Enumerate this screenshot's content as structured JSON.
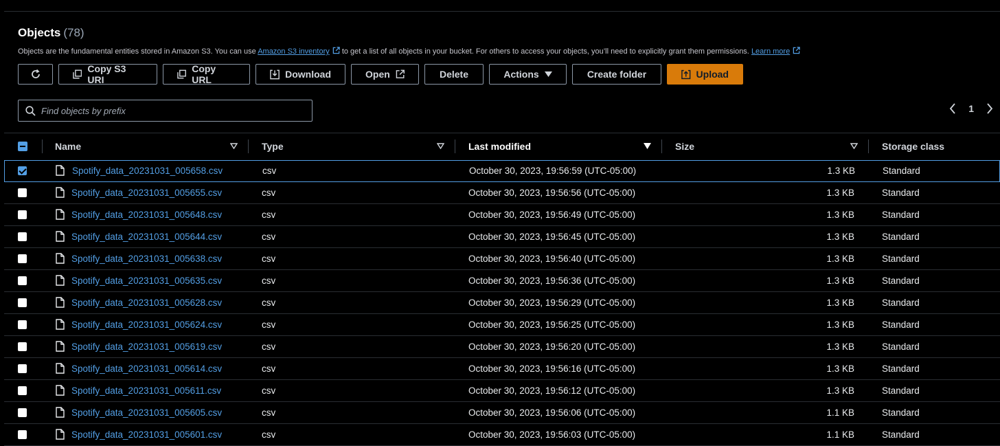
{
  "header": {
    "title": "Objects",
    "count": "(78)",
    "description_prefix": "Objects are the fundamental entities stored in Amazon S3. You can use",
    "inventory_link": "Amazon S3 inventory",
    "description_middle": "to get a list of all objects in your bucket. For others to access your objects, you’ll need to explicitly grant them permissions.",
    "learn_more": "Learn more"
  },
  "toolbar": {
    "copy_s3_uri": "Copy S3 URI",
    "copy_url": "Copy URL",
    "download": "Download",
    "open": "Open",
    "delete": "Delete",
    "actions": "Actions",
    "create_folder": "Create folder",
    "upload": "Upload"
  },
  "search": {
    "placeholder": "Find objects by prefix"
  },
  "pagination": {
    "page": "1"
  },
  "columns": {
    "name": "Name",
    "type": "Type",
    "last_modified": "Last modified",
    "size": "Size",
    "storage_class": "Storage class"
  },
  "rows": [
    {
      "name": "Spotify_data_20231031_005658.csv",
      "type": "csv",
      "modified": "October 30, 2023, 19:56:59 (UTC-05:00)",
      "size": "1.3 KB",
      "storage": "Standard",
      "selected": true
    },
    {
      "name": "Spotify_data_20231031_005655.csv",
      "type": "csv",
      "modified": "October 30, 2023, 19:56:56 (UTC-05:00)",
      "size": "1.3 KB",
      "storage": "Standard",
      "selected": false
    },
    {
      "name": "Spotify_data_20231031_005648.csv",
      "type": "csv",
      "modified": "October 30, 2023, 19:56:49 (UTC-05:00)",
      "size": "1.3 KB",
      "storage": "Standard",
      "selected": false
    },
    {
      "name": "Spotify_data_20231031_005644.csv",
      "type": "csv",
      "modified": "October 30, 2023, 19:56:45 (UTC-05:00)",
      "size": "1.3 KB",
      "storage": "Standard",
      "selected": false
    },
    {
      "name": "Spotify_data_20231031_005638.csv",
      "type": "csv",
      "modified": "October 30, 2023, 19:56:40 (UTC-05:00)",
      "size": "1.3 KB",
      "storage": "Standard",
      "selected": false
    },
    {
      "name": "Spotify_data_20231031_005635.csv",
      "type": "csv",
      "modified": "October 30, 2023, 19:56:36 (UTC-05:00)",
      "size": "1.3 KB",
      "storage": "Standard",
      "selected": false
    },
    {
      "name": "Spotify_data_20231031_005628.csv",
      "type": "csv",
      "modified": "October 30, 2023, 19:56:29 (UTC-05:00)",
      "size": "1.3 KB",
      "storage": "Standard",
      "selected": false
    },
    {
      "name": "Spotify_data_20231031_005624.csv",
      "type": "csv",
      "modified": "October 30, 2023, 19:56:25 (UTC-05:00)",
      "size": "1.3 KB",
      "storage": "Standard",
      "selected": false
    },
    {
      "name": "Spotify_data_20231031_005619.csv",
      "type": "csv",
      "modified": "October 30, 2023, 19:56:20 (UTC-05:00)",
      "size": "1.3 KB",
      "storage": "Standard",
      "selected": false
    },
    {
      "name": "Spotify_data_20231031_005614.csv",
      "type": "csv",
      "modified": "October 30, 2023, 19:56:16 (UTC-05:00)",
      "size": "1.3 KB",
      "storage": "Standard",
      "selected": false
    },
    {
      "name": "Spotify_data_20231031_005611.csv",
      "type": "csv",
      "modified": "October 30, 2023, 19:56:12 (UTC-05:00)",
      "size": "1.3 KB",
      "storage": "Standard",
      "selected": false
    },
    {
      "name": "Spotify_data_20231031_005605.csv",
      "type": "csv",
      "modified": "October 30, 2023, 19:56:06 (UTC-05:00)",
      "size": "1.1 KB",
      "storage": "Standard",
      "selected": false
    },
    {
      "name": "Spotify_data_20231031_005601.csv",
      "type": "csv",
      "modified": "October 30, 2023, 19:56:03 (UTC-05:00)",
      "size": "1.1 KB",
      "storage": "Standard",
      "selected": false
    }
  ],
  "colors": {
    "background": "#000000",
    "link": "#539fe5",
    "primary_button": "#d97b0a",
    "border": "#8d99a8"
  }
}
